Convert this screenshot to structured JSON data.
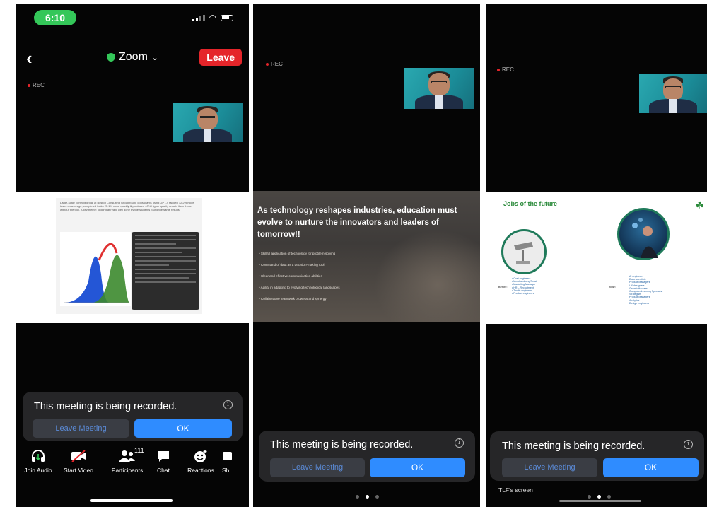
{
  "status_bar": {
    "time": "6:10"
  },
  "header": {
    "meeting_title": "Zoom",
    "dropdown_glyph": "⌄",
    "leave_label": "Leave",
    "back_glyph": "‹"
  },
  "rec_label": "REC",
  "slide1": {
    "caption": "Large-scale controlled trial at Boston Consulting Group found consultants using GPT-4 tackled 12.2% more tasks on average, completed tasks 25.1% more quickly & produced 40% higher quality results than those without the tool. A key theme: looking at really well done by the students found the same results."
  },
  "slide2": {
    "headline": "As technology reshapes industries, education must evolve to nurture the innovators and leaders of tomorrow!!",
    "bullets": [
      "Skillful application of technology for problem-solving",
      "Command of data as a decision-making tool",
      "Clear and effective communication abilities",
      "Agility in adapting to evolving technological landscapes",
      "Collaborative teamwork prowess and synergy"
    ]
  },
  "slide3": {
    "title": "Jobs of the future",
    "before_label": "Before:",
    "now_label": "Now:",
    "before_list": "• Cost engineers\n• Merchandising/Retail\n• Marketing Manager\n• HR – Recruitment\n• Textile engineers\n• Product engineers",
    "now_list": "AI engineers\nData scientists\nProduct Managers\nUX designers\nGrowth Hackers\nComputer/Learning Specialist\nStrategists\nProduct Managers\nAnalytics\nDesign engineers"
  },
  "banner": {
    "message": "This meeting is being recorded.",
    "leave_meeting_label": "Leave Meeting",
    "ok_label": "OK",
    "info_glyph": "i"
  },
  "toolbar": {
    "items": [
      {
        "label": "Join Audio",
        "icon": "headphones-icon"
      },
      {
        "label": "Start Video",
        "icon": "video-off-icon"
      },
      {
        "label": "Participants",
        "icon": "participants-icon",
        "badge": "111"
      },
      {
        "label": "Chat",
        "icon": "chat-icon"
      },
      {
        "label": "Reactions",
        "icon": "reactions-icon"
      },
      {
        "label": "Sh",
        "icon": "share-icon"
      }
    ]
  },
  "screen_label": "TLF's screen"
}
